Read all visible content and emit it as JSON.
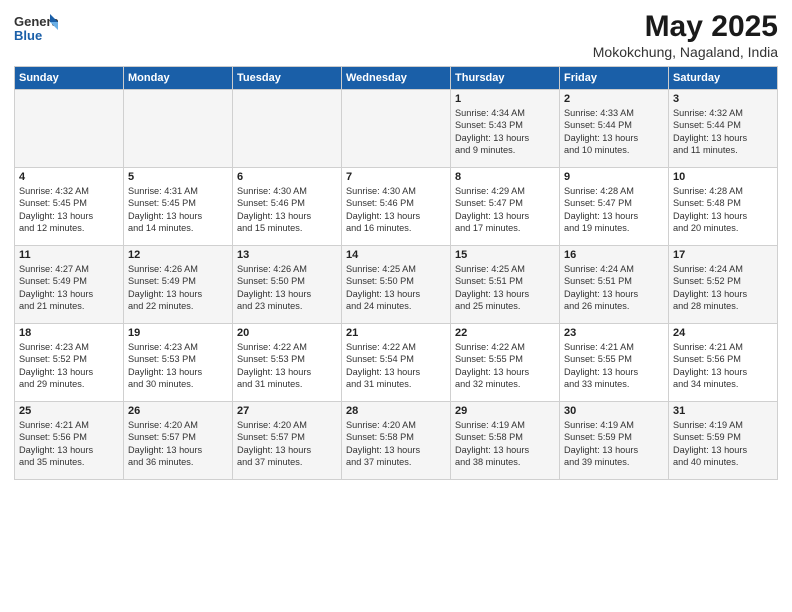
{
  "logo": {
    "general": "General",
    "blue": "Blue"
  },
  "title": "May 2025",
  "subtitle": "Mokokchung, Nagaland, India",
  "days_header": [
    "Sunday",
    "Monday",
    "Tuesday",
    "Wednesday",
    "Thursday",
    "Friday",
    "Saturday"
  ],
  "weeks": [
    [
      {
        "day": "",
        "content": ""
      },
      {
        "day": "",
        "content": ""
      },
      {
        "day": "",
        "content": ""
      },
      {
        "day": "",
        "content": ""
      },
      {
        "day": "1",
        "content": "Sunrise: 4:34 AM\nSunset: 5:43 PM\nDaylight: 13 hours\nand 9 minutes."
      },
      {
        "day": "2",
        "content": "Sunrise: 4:33 AM\nSunset: 5:44 PM\nDaylight: 13 hours\nand 10 minutes."
      },
      {
        "day": "3",
        "content": "Sunrise: 4:32 AM\nSunset: 5:44 PM\nDaylight: 13 hours\nand 11 minutes."
      }
    ],
    [
      {
        "day": "4",
        "content": "Sunrise: 4:32 AM\nSunset: 5:45 PM\nDaylight: 13 hours\nand 12 minutes."
      },
      {
        "day": "5",
        "content": "Sunrise: 4:31 AM\nSunset: 5:45 PM\nDaylight: 13 hours\nand 14 minutes."
      },
      {
        "day": "6",
        "content": "Sunrise: 4:30 AM\nSunset: 5:46 PM\nDaylight: 13 hours\nand 15 minutes."
      },
      {
        "day": "7",
        "content": "Sunrise: 4:30 AM\nSunset: 5:46 PM\nDaylight: 13 hours\nand 16 minutes."
      },
      {
        "day": "8",
        "content": "Sunrise: 4:29 AM\nSunset: 5:47 PM\nDaylight: 13 hours\nand 17 minutes."
      },
      {
        "day": "9",
        "content": "Sunrise: 4:28 AM\nSunset: 5:47 PM\nDaylight: 13 hours\nand 19 minutes."
      },
      {
        "day": "10",
        "content": "Sunrise: 4:28 AM\nSunset: 5:48 PM\nDaylight: 13 hours\nand 20 minutes."
      }
    ],
    [
      {
        "day": "11",
        "content": "Sunrise: 4:27 AM\nSunset: 5:49 PM\nDaylight: 13 hours\nand 21 minutes."
      },
      {
        "day": "12",
        "content": "Sunrise: 4:26 AM\nSunset: 5:49 PM\nDaylight: 13 hours\nand 22 minutes."
      },
      {
        "day": "13",
        "content": "Sunrise: 4:26 AM\nSunset: 5:50 PM\nDaylight: 13 hours\nand 23 minutes."
      },
      {
        "day": "14",
        "content": "Sunrise: 4:25 AM\nSunset: 5:50 PM\nDaylight: 13 hours\nand 24 minutes."
      },
      {
        "day": "15",
        "content": "Sunrise: 4:25 AM\nSunset: 5:51 PM\nDaylight: 13 hours\nand 25 minutes."
      },
      {
        "day": "16",
        "content": "Sunrise: 4:24 AM\nSunset: 5:51 PM\nDaylight: 13 hours\nand 26 minutes."
      },
      {
        "day": "17",
        "content": "Sunrise: 4:24 AM\nSunset: 5:52 PM\nDaylight: 13 hours\nand 28 minutes."
      }
    ],
    [
      {
        "day": "18",
        "content": "Sunrise: 4:23 AM\nSunset: 5:52 PM\nDaylight: 13 hours\nand 29 minutes."
      },
      {
        "day": "19",
        "content": "Sunrise: 4:23 AM\nSunset: 5:53 PM\nDaylight: 13 hours\nand 30 minutes."
      },
      {
        "day": "20",
        "content": "Sunrise: 4:22 AM\nSunset: 5:53 PM\nDaylight: 13 hours\nand 31 minutes."
      },
      {
        "day": "21",
        "content": "Sunrise: 4:22 AM\nSunset: 5:54 PM\nDaylight: 13 hours\nand 31 minutes."
      },
      {
        "day": "22",
        "content": "Sunrise: 4:22 AM\nSunset: 5:55 PM\nDaylight: 13 hours\nand 32 minutes."
      },
      {
        "day": "23",
        "content": "Sunrise: 4:21 AM\nSunset: 5:55 PM\nDaylight: 13 hours\nand 33 minutes."
      },
      {
        "day": "24",
        "content": "Sunrise: 4:21 AM\nSunset: 5:56 PM\nDaylight: 13 hours\nand 34 minutes."
      }
    ],
    [
      {
        "day": "25",
        "content": "Sunrise: 4:21 AM\nSunset: 5:56 PM\nDaylight: 13 hours\nand 35 minutes."
      },
      {
        "day": "26",
        "content": "Sunrise: 4:20 AM\nSunset: 5:57 PM\nDaylight: 13 hours\nand 36 minutes."
      },
      {
        "day": "27",
        "content": "Sunrise: 4:20 AM\nSunset: 5:57 PM\nDaylight: 13 hours\nand 37 minutes."
      },
      {
        "day": "28",
        "content": "Sunrise: 4:20 AM\nSunset: 5:58 PM\nDaylight: 13 hours\nand 37 minutes."
      },
      {
        "day": "29",
        "content": "Sunrise: 4:19 AM\nSunset: 5:58 PM\nDaylight: 13 hours\nand 38 minutes."
      },
      {
        "day": "30",
        "content": "Sunrise: 4:19 AM\nSunset: 5:59 PM\nDaylight: 13 hours\nand 39 minutes."
      },
      {
        "day": "31",
        "content": "Sunrise: 4:19 AM\nSunset: 5:59 PM\nDaylight: 13 hours\nand 40 minutes."
      }
    ]
  ]
}
